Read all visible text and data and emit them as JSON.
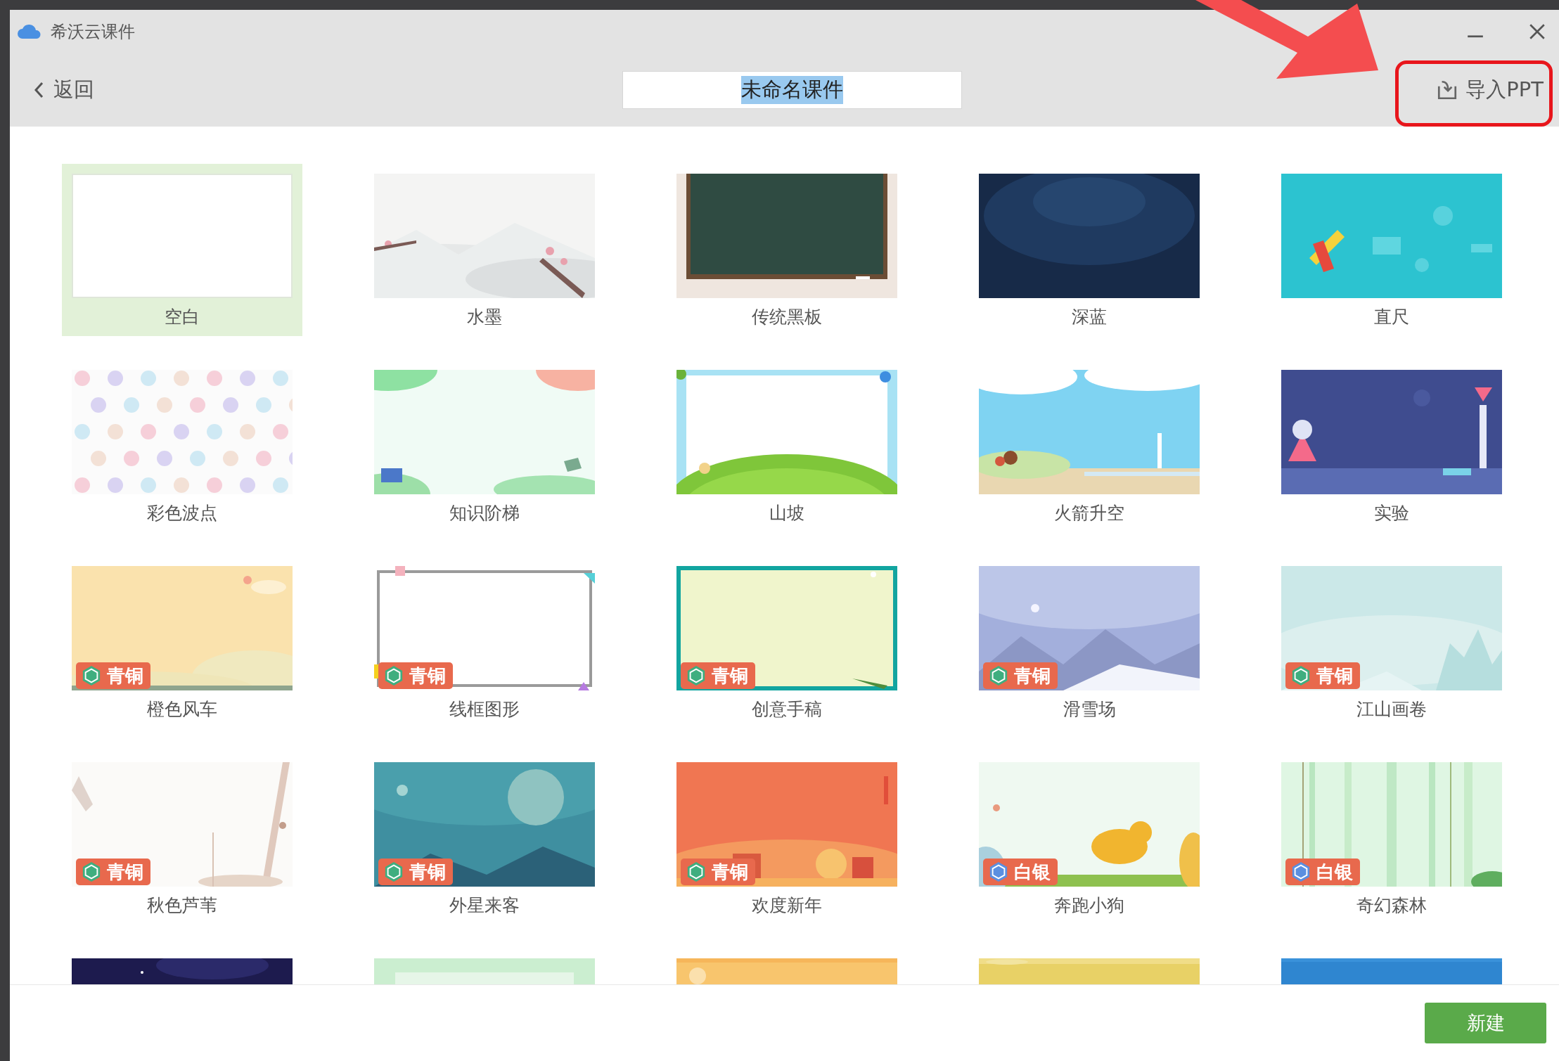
{
  "window": {
    "title": "希沃云课件"
  },
  "toolbar": {
    "back_button": "返回",
    "title_field": {
      "value": "未命名课件",
      "value_selected": true
    },
    "import_button": "导入PPT"
  },
  "templates": [
    {
      "name": "空白",
      "selected": true,
      "kind": "blank"
    },
    {
      "name": "水墨",
      "selected": false,
      "kind": "picture"
    },
    {
      "name": "传统黑板",
      "selected": false,
      "kind": "picture"
    },
    {
      "name": "深蓝",
      "selected": false,
      "kind": "picture"
    },
    {
      "name": "直尺",
      "selected": false,
      "kind": "picture"
    },
    {
      "name": "彩色波点",
      "selected": false,
      "kind": "picture"
    },
    {
      "name": "知识阶梯",
      "selected": false,
      "kind": "picture"
    },
    {
      "name": "山坡",
      "selected": false,
      "kind": "picture"
    },
    {
      "name": "火箭升空",
      "selected": false,
      "kind": "picture"
    },
    {
      "name": "实验",
      "selected": false,
      "kind": "picture"
    },
    {
      "name": "橙色风车",
      "selected": false,
      "kind": "picture",
      "badge": {
        "color": "#3fae7f",
        "label": "青铜"
      }
    },
    {
      "name": "线框图形",
      "selected": false,
      "kind": "picture",
      "badge": {
        "color": "#3fae7f",
        "label": "青铜"
      }
    },
    {
      "name": "创意手稿",
      "selected": false,
      "kind": "picture",
      "badge": {
        "color": "#3fae7f",
        "label": "青铜"
      }
    },
    {
      "name": "滑雪场",
      "selected": false,
      "kind": "picture",
      "badge": {
        "color": "#3fae7f",
        "label": "青铜"
      }
    },
    {
      "name": "江山画卷",
      "selected": false,
      "kind": "picture",
      "badge": {
        "color": "#3fae7f",
        "label": "青铜"
      }
    },
    {
      "name": "秋色芦苇",
      "selected": false,
      "kind": "picture",
      "badge": {
        "color": "#3fae7f",
        "label": "青铜"
      }
    },
    {
      "name": "外星来客",
      "selected": false,
      "kind": "picture",
      "badge": {
        "color": "#3fae7f",
        "label": "青铜"
      }
    },
    {
      "name": "欢度新年",
      "selected": false,
      "kind": "picture",
      "badge": {
        "color": "#3fae7f",
        "label": "青铜"
      }
    },
    {
      "name": "奔跑小狗",
      "selected": false,
      "kind": "picture",
      "badge": {
        "color": "#5b8fe0",
        "label": "白银"
      }
    },
    {
      "name": "奇幻森林",
      "selected": false,
      "kind": "picture",
      "badge": {
        "color": "#5b8fe0",
        "label": "白银"
      }
    }
  ],
  "footer": {
    "create_button": "新建"
  }
}
